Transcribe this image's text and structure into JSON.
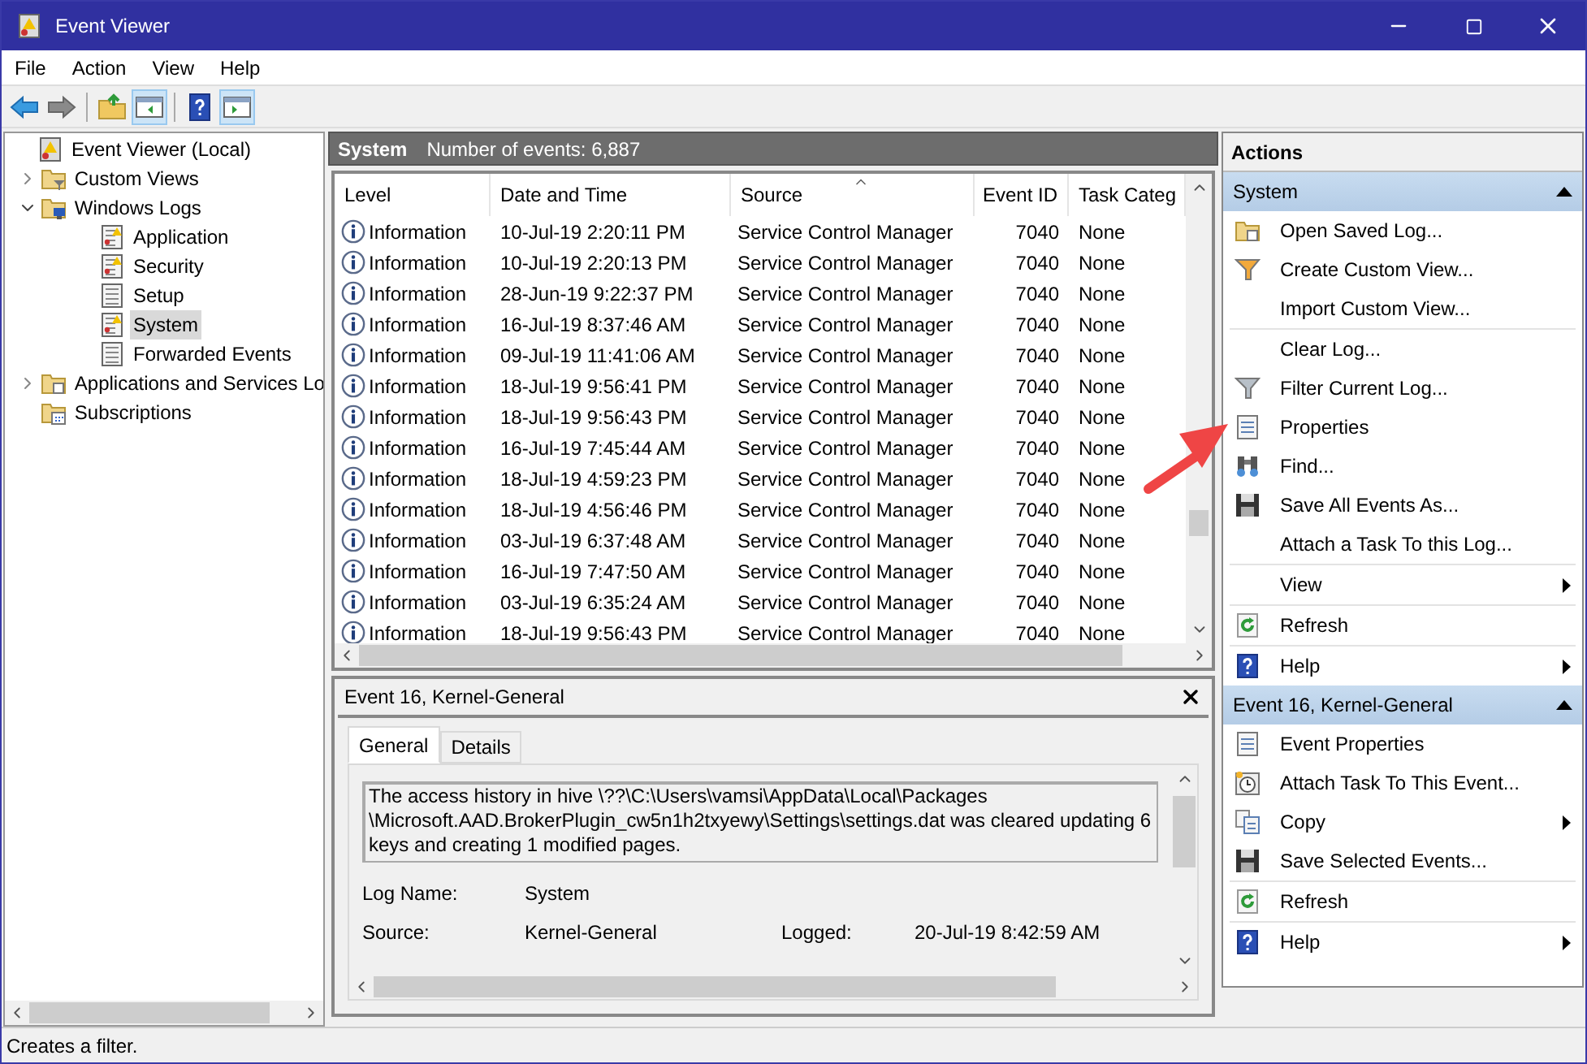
{
  "window": {
    "title": "Event Viewer"
  },
  "menu": [
    "File",
    "Action",
    "View",
    "Help"
  ],
  "toolbar": [
    {
      "kind": "back",
      "pressed": false
    },
    {
      "kind": "forward",
      "pressed": false
    },
    {
      "kind": "up",
      "pressed": false
    },
    {
      "kind": "tree",
      "pressed": true
    },
    {
      "kind": "help",
      "pressed": false
    },
    {
      "kind": "pane",
      "pressed": true
    }
  ],
  "tree": [
    {
      "label": "Event Viewer (Local)",
      "kind": "root",
      "selected": false,
      "children": [
        {
          "label": "Custom Views",
          "kind": "filterfolder",
          "selected": false,
          "expanded": false
        },
        {
          "label": "Windows Logs",
          "kind": "logsfolder",
          "selected": false,
          "expanded": true,
          "children": [
            {
              "label": "Application",
              "kind": "log",
              "selected": false
            },
            {
              "label": "Security",
              "kind": "log",
              "selected": false
            },
            {
              "label": "Setup",
              "kind": "plainlog",
              "selected": false
            },
            {
              "label": "System",
              "kind": "log",
              "selected": true
            },
            {
              "label": "Forwarded Events",
              "kind": "plainlog",
              "selected": false
            }
          ]
        },
        {
          "label": "Applications and Services Lo",
          "kind": "folder",
          "selected": false,
          "expanded": false
        },
        {
          "label": "Subscriptions",
          "kind": "subfolder",
          "selected": false
        }
      ]
    }
  ],
  "log_header": {
    "title": "System",
    "count": "Number of events: 6,887"
  },
  "table": {
    "columns": [
      {
        "label": "Level",
        "sorted": false
      },
      {
        "label": "Date and Time",
        "sorted": false
      },
      {
        "label": "Source",
        "sorted": true
      },
      {
        "label": "Event ID",
        "sorted": false
      },
      {
        "label": "Task Categ",
        "sorted": false
      }
    ],
    "rows": [
      {
        "level": "Information",
        "date": "10-Jul-19 2:20:11 PM",
        "source": "Service Control Manager",
        "event_id": "7040",
        "task": "None"
      },
      {
        "level": "Information",
        "date": "10-Jul-19 2:20:13 PM",
        "source": "Service Control Manager",
        "event_id": "7040",
        "task": "None"
      },
      {
        "level": "Information",
        "date": "28-Jun-19 9:22:37 PM",
        "source": "Service Control Manager",
        "event_id": "7040",
        "task": "None"
      },
      {
        "level": "Information",
        "date": "16-Jul-19 8:37:46 AM",
        "source": "Service Control Manager",
        "event_id": "7040",
        "task": "None"
      },
      {
        "level": "Information",
        "date": "09-Jul-19 11:41:06 AM",
        "source": "Service Control Manager",
        "event_id": "7040",
        "task": "None"
      },
      {
        "level": "Information",
        "date": "18-Jul-19 9:56:41 PM",
        "source": "Service Control Manager",
        "event_id": "7040",
        "task": "None"
      },
      {
        "level": "Information",
        "date": "18-Jul-19 9:56:43 PM",
        "source": "Service Control Manager",
        "event_id": "7040",
        "task": "None"
      },
      {
        "level": "Information",
        "date": "16-Jul-19 7:45:44 AM",
        "source": "Service Control Manager",
        "event_id": "7040",
        "task": "None"
      },
      {
        "level": "Information",
        "date": "18-Jul-19 4:59:23 PM",
        "source": "Service Control Manager",
        "event_id": "7040",
        "task": "None"
      },
      {
        "level": "Information",
        "date": "18-Jul-19 4:56:46 PM",
        "source": "Service Control Manager",
        "event_id": "7040",
        "task": "None"
      },
      {
        "level": "Information",
        "date": "03-Jul-19 6:37:48 AM",
        "source": "Service Control Manager",
        "event_id": "7040",
        "task": "None"
      },
      {
        "level": "Information",
        "date": "16-Jul-19 7:47:50 AM",
        "source": "Service Control Manager",
        "event_id": "7040",
        "task": "None"
      },
      {
        "level": "Information",
        "date": "03-Jul-19 6:35:24 AM",
        "source": "Service Control Manager",
        "event_id": "7040",
        "task": "None"
      },
      {
        "level": "Information",
        "date": "18-Jul-19 9:56:43 PM",
        "source": "Service Control Manager",
        "event_id": "7040",
        "task": "None"
      }
    ]
  },
  "detail": {
    "title": "Event 16, Kernel-General",
    "tabs": [
      {
        "label": "General",
        "selected": true
      },
      {
        "label": "Details",
        "selected": false
      }
    ],
    "description": "The access history in hive \\??\\C:\\Users\\vamsi\\AppData\\Local\\Packages \\Microsoft.AAD.BrokerPlugin_cw5n1h2txyewy\\Settings\\settings.dat was cleared updating 6 keys and creating 1 modified pages.",
    "field_rows": [
      [
        {
          "label": "Log Name:",
          "value": "System"
        }
      ],
      [
        {
          "label": "Source:",
          "value": "Kernel-General"
        },
        {
          "label": "Logged:",
          "value": "20-Jul-19 8:42:59 AM"
        }
      ]
    ]
  },
  "actions": {
    "title": "Actions",
    "sections": [
      {
        "title": "System",
        "expanded": true,
        "groups": [
          [
            {
              "label": "Open Saved Log...",
              "kind": "folder",
              "submenu": false
            },
            {
              "label": "Create Custom View...",
              "kind": "funnel",
              "submenu": false
            },
            {
              "label": "Import Custom View...",
              "kind": "none",
              "submenu": false
            }
          ],
          [
            {
              "label": "Clear Log...",
              "kind": "none",
              "submenu": false
            },
            {
              "label": "Filter Current Log...",
              "kind": "grayfunnel",
              "submenu": false
            },
            {
              "label": "Properties",
              "kind": "sheet",
              "submenu": false
            },
            {
              "label": "Find...",
              "kind": "binoculars",
              "submenu": false
            },
            {
              "label": "Save All Events As...",
              "kind": "disk",
              "submenu": false
            },
            {
              "label": "Attach a Task To this Log...",
              "kind": "none",
              "submenu": false
            }
          ],
          [
            {
              "label": "View",
              "kind": "none",
              "submenu": true
            }
          ],
          [
            {
              "label": "Refresh",
              "kind": "refresh",
              "submenu": false
            }
          ],
          [
            {
              "label": "Help",
              "kind": "help",
              "submenu": true
            }
          ]
        ]
      },
      {
        "title": "Event 16, Kernel-General",
        "expanded": true,
        "groups": [
          [
            {
              "label": "Event Properties",
              "kind": "sheet",
              "submenu": false
            },
            {
              "label": "Attach Task To This Event...",
              "kind": "clock",
              "submenu": false
            },
            {
              "label": "Copy",
              "kind": "copy",
              "submenu": true
            },
            {
              "label": "Save Selected Events...",
              "kind": "disk",
              "submenu": false
            }
          ],
          [
            {
              "label": "Refresh",
              "kind": "refresh",
              "submenu": false
            }
          ],
          [
            {
              "label": "Help",
              "kind": "help",
              "submenu": true
            }
          ]
        ]
      }
    ]
  },
  "status_bar": "Creates a filter."
}
